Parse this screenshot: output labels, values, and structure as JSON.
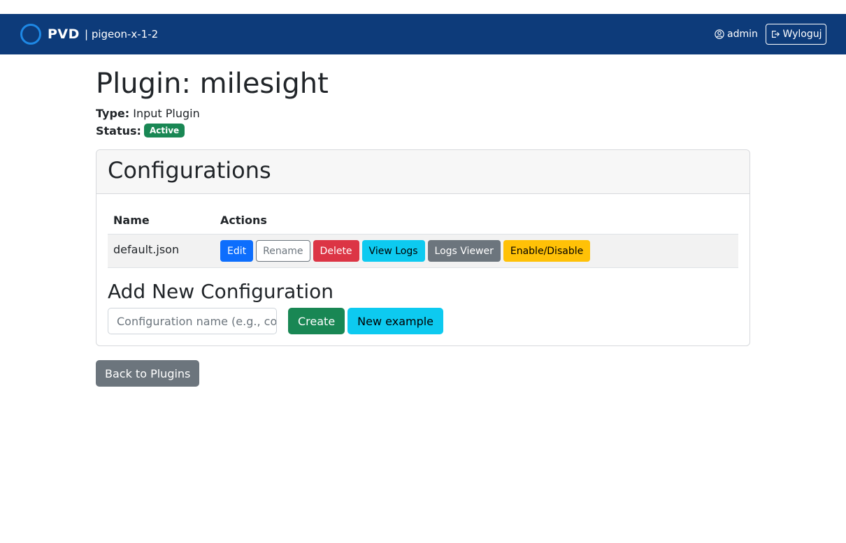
{
  "navbar": {
    "brand": "PVD",
    "host": "| pigeon-x-1-2",
    "user": "admin",
    "logout_label": "Wyloguj",
    "accent_color": "#1e88e5",
    "background_color": "#0d3b7a"
  },
  "page": {
    "title": "Plugin: milesight",
    "type_label": "Type:",
    "type_value": "Input Plugin",
    "status_label": "Status:",
    "status_value": "Active"
  },
  "configurations": {
    "heading": "Configurations",
    "columns": [
      "Name",
      "Actions"
    ],
    "rows": [
      {
        "name": "default.json",
        "actions": [
          "Edit",
          "Rename",
          "Delete",
          "View Logs",
          "Logs Viewer",
          "Enable/Disable"
        ]
      }
    ]
  },
  "add_config": {
    "heading": "Add New Configuration",
    "input_placeholder": "Configuration name (e.g., conf",
    "create_label": "Create",
    "example_label": "New example"
  },
  "back_label": "Back to Plugins",
  "icons": {
    "user": "user-circle-icon",
    "logout": "sign-out-icon",
    "logo": "circle-logo-icon"
  }
}
